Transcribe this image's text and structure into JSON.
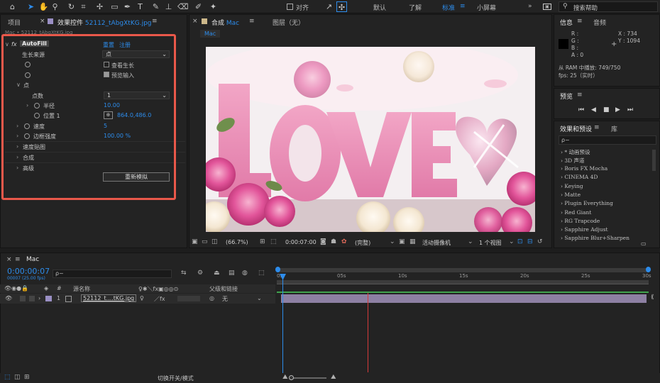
{
  "toolbar": {
    "align_label": "对齐",
    "workspaces": [
      "默认",
      "了解",
      "标准",
      "小屏幕"
    ],
    "active_workspace": "标准",
    "more": "»",
    "search_placeholder": "搜索帮助"
  },
  "left_panel": {
    "tab_project": "项目",
    "tab_effects": "效果控件",
    "tab_effects_file": "52112_tAbgXtKG.jpg",
    "breadcrumb": "Mac • 52112_tAbgXtKG.jpg",
    "effect_name": "AutoFill",
    "reset": "重置",
    "register": "注册",
    "rows": {
      "growth_source_label": "生长来源",
      "growth_source_value": "点",
      "view_growth": "查看生长",
      "preview_input": "预览输入",
      "point_group": "点",
      "point_count_label": "点数",
      "point_count_value": "1",
      "radius_label": "半径",
      "radius_value": "10.00",
      "position_label": "位置 1",
      "position_value": "864.0,486.0",
      "speed_label": "速度",
      "speed_value": "5",
      "edge_label": "边框强度",
      "edge_value": "100.00 %",
      "speed_map": "速度贴图",
      "composite": "合成",
      "advanced": "高级",
      "resimulate": "重新模拟"
    }
  },
  "comp_panel": {
    "tab_comp": "合成",
    "comp_name": "Mac",
    "tab_layer": "图层（无）",
    "subtab": "Mac",
    "image_text": "LOVE",
    "zoom": "(66.7%)",
    "timecode": "0:00:07:00",
    "quality": "(完整)",
    "camera": "活动摄像机",
    "views": "1 个视图"
  },
  "info_panel": {
    "tab_info": "信息",
    "tab_audio": "音频",
    "r": "R :",
    "g": "G :",
    "b": "B :",
    "a": "A :  0",
    "x": "X : 734",
    "y": "Y : 1094",
    "ram": "从 RAM 中播放: 749/750",
    "fps": "fps: 25（实时）"
  },
  "preview_panel": {
    "title": "预览"
  },
  "effects_panel": {
    "tab": "效果和预设",
    "tab_lib": "库",
    "search_placeholder": "ρ~",
    "items": [
      "* 动画预设",
      "3D 声道",
      "Boris FX Mocha",
      "CINEMA 4D",
      "Keying",
      "Matte",
      "Plugin Everything",
      "Red Giant",
      "RG Trapcode",
      "Sapphire Adjust",
      "Sapphire Blur+Sharpen"
    ]
  },
  "timeline": {
    "tab": "Mac",
    "timecode": "0:00:00:07",
    "timecode_sub": "00007 (25.00 fps)",
    "search_placeholder": "ρ~",
    "col_source": "源名称",
    "col_parent": "父级和链接",
    "layer_num": "1",
    "layer_name": "52112_t....tKG.jpg",
    "parent_value": "无",
    "ticks": [
      "0s",
      "05s",
      "10s",
      "15s",
      "20s",
      "25s",
      "30s"
    ],
    "footer_toggle": "切换开关/模式"
  },
  "colors": {
    "accent": "#2d8ceb",
    "highlight_box": "#e9584a",
    "layer_bar": "#8d80a3",
    "playhead_red": "#d73a3a"
  }
}
